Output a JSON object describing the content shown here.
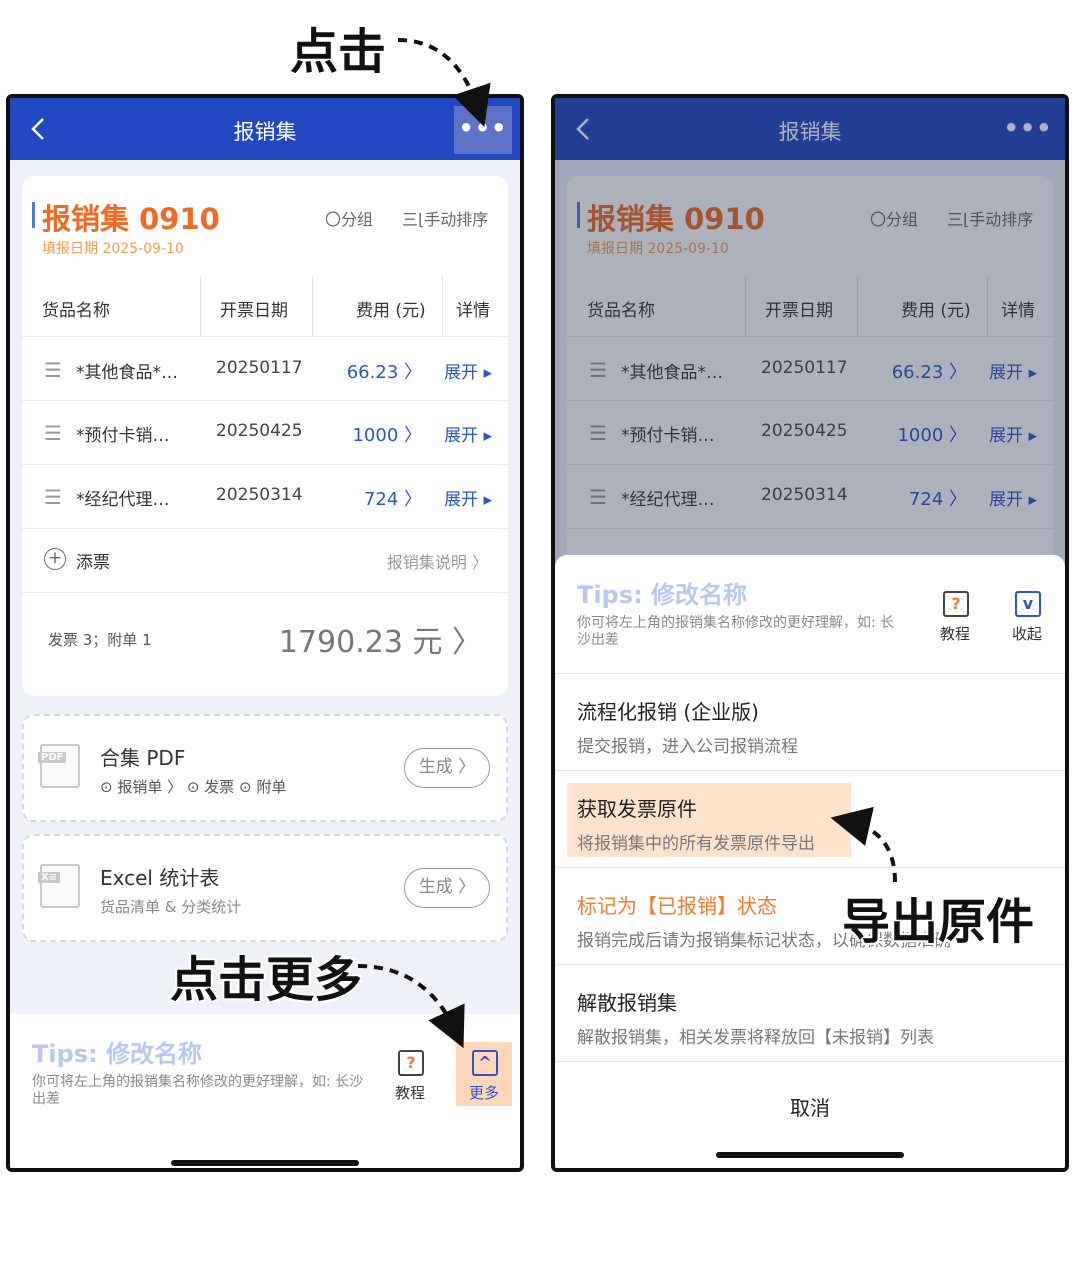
{
  "annotations": {
    "top": "点击",
    "bottom_left": "点击更多",
    "right": "导出原件"
  },
  "nav": {
    "title": "报销集",
    "more": "•••"
  },
  "set": {
    "name": "报销集 0910",
    "date": "填报日期 2025-09-10",
    "group": "〇分组",
    "sort": "三⌊手动排序"
  },
  "table": {
    "headers": {
      "name": "货品名称",
      "date": "开票日期",
      "fee": "费用 (元)",
      "detail": "详情"
    },
    "rows": [
      {
        "name": "*其他食品*…",
        "date": "20250117",
        "fee": "66.23 〉",
        "expand": "展开 ▸"
      },
      {
        "name": "*预付卡销…",
        "date": "20250425",
        "fee": "1000 〉",
        "expand": "展开 ▸"
      },
      {
        "name": "*经纪代理…",
        "date": "20250314",
        "fee": "724 〉",
        "expand": "展开 ▸"
      }
    ]
  },
  "add": {
    "label": "添票",
    "explain": "报销集说明 〉"
  },
  "summary": {
    "counts": "发票 3；附单 1",
    "total": "1790.23 元 〉"
  },
  "pdf": {
    "tag": "PDF",
    "title": "合集 PDF",
    "options": "⊙ 报销单 〉  ⊙ 发票  ⊙ 附单",
    "button": "生成 〉"
  },
  "excel": {
    "tag": "X≡",
    "title": "Excel 统计表",
    "sub": "货品清单 & 分类统计",
    "button": "生成 〉"
  },
  "tips": {
    "title": "Tips: 修改名称",
    "desc": "你可将左上角的报销集名称修改的更好理解，如: 长沙出差"
  },
  "toolbar": {
    "tutorial": "教程",
    "more": "更多",
    "collapse": "收起"
  },
  "sheet": {
    "items": [
      {
        "title": "流程化报销 (企业版)",
        "desc": "提交报销，进入公司报销流程"
      },
      {
        "title": "获取发票原件",
        "desc": "将报销集中的所有发票原件导出"
      },
      {
        "title": "标记为【已报销】状态",
        "desc": "报销完成后请为报销集标记状态，以确保数据准确"
      },
      {
        "title": "解散报销集",
        "desc": "解散报销集，相关发票将释放回【未报销】列表"
      }
    ],
    "cancel": "取消"
  },
  "colors": {
    "nav": "#2148c0",
    "accent_orange": "#f26a21",
    "link_blue": "#2b55c9",
    "highlight": "#ffcba0"
  }
}
